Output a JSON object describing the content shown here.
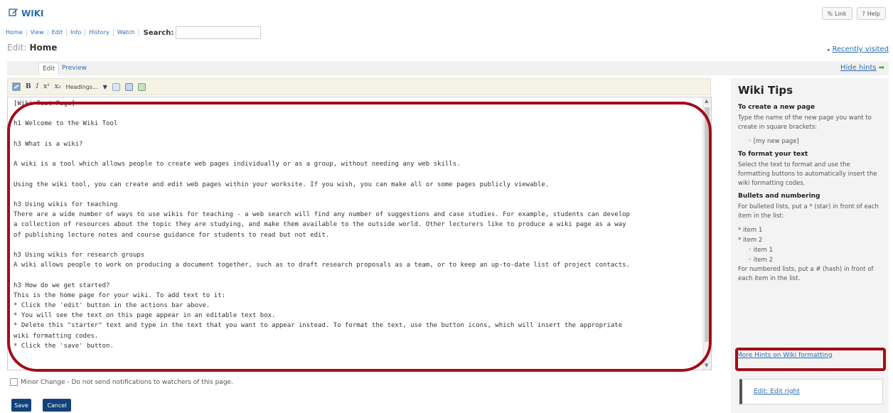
{
  "header": {
    "app_title": "WIKI",
    "link_label": "Link",
    "help_label": "Help"
  },
  "toolbar": {
    "links": [
      "Home",
      "View",
      "Edit",
      "Info",
      "History",
      "Watch"
    ],
    "search_label": "Search:",
    "search_value": ""
  },
  "page": {
    "heading_prefix": "Edit:",
    "heading_title": "Home",
    "recently_visited": "Recently visited"
  },
  "tabs": {
    "edit": "Edit",
    "preview": "Preview",
    "hide_hints": "Hide hints"
  },
  "editor_toolbar": {
    "bold": "B",
    "italic": "I",
    "superscript": "x²",
    "subscript": "x₂",
    "headings": "Headings..."
  },
  "editor": {
    "content": "[Wiki Test Page]\n\nh1 Welcome to the Wiki Tool\n\nh3 What is a wiki?\n\nA wiki is a tool which allows people to create web pages individually or as a group, without needing any web skills.\n\nUsing the wiki tool, you can create and edit web pages within your worksite. If you wish, you can make all or some pages publicly viewable.\n\nh3 Using wikis for teaching\nThere are a wide number of ways to use wikis for teaching - a web search will find any number of suggestions and case studies. For example, students can develop\na collection of resources about the topic they are studying, and make them available to the outside world. Other lecturers like to produce a wiki page as a way\nof publishing lecture notes and course guidance for students to read but not edit.\n\nh3 Using wikis for research groups\nA wiki allows people to work on producing a document together, such as to draft research proposals as a team, or to keep an up-to-date list of project contacts.\n\nh3 How do we get started?\nThis is the home page for your wiki. To add text to it:\n* Click the 'edit' button in the actions bar above.\n* You will see the text on this page appear in an editable text box.\n* Delete this \"starter\" text and type in the text that you want to appear instead. To format the text, use the button icons, which will insert the appropriate\nwiki formatting codes.\n* Click the 'save' button."
  },
  "form": {
    "minor_change": "Minor Change - Do not send notifications to watchers of this page.",
    "save": "Save",
    "cancel": "Cancel"
  },
  "tips": {
    "title": "Wiki Tips",
    "new_page_heading": "To create a new page",
    "new_page_text": "Type the name of the new page you want to create in square brackets:",
    "new_page_example": "[my new page]",
    "format_heading": "To format your text",
    "format_text": "Select the text to format and use the formatting buttons to automatically insert the wiki formatting codes.",
    "bullets_heading": "Bullets and numbering",
    "bullets_text": "For bulleted lists, put a * (star) in front of each item in the list:",
    "item1": "* item 1",
    "item2": "* item 2",
    "subitem1": "item 1",
    "subitem2": "item 2",
    "numbered_text": "For numbered lists, put a # (hash) in front of each item in the list.",
    "more_hints": "More Hints on Wiki formatting",
    "edit_right": "Edit: Edit right"
  },
  "colors": {
    "link": "#2b6cb0",
    "button": "#13427a",
    "highlight": "#a30d17"
  }
}
